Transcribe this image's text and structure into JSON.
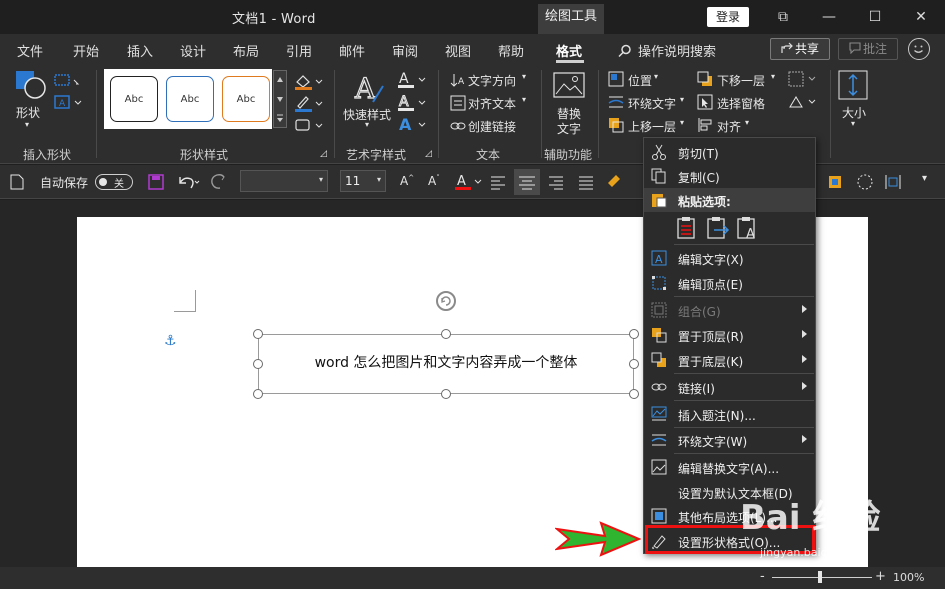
{
  "titlebar": {
    "doc_title": "文档1  -  Word",
    "context_tab": "绘图工具",
    "login": "登录",
    "restore_glyph": "⧉",
    "min_glyph": "—",
    "max_glyph": "☐",
    "close_glyph": "✕"
  },
  "tabs": [
    "文件",
    "开始",
    "插入",
    "设计",
    "布局",
    "引用",
    "邮件",
    "审阅",
    "视图",
    "帮助",
    "格式"
  ],
  "active_tab": "格式",
  "search": "操作说明搜索",
  "share": "共享",
  "comment": "批注",
  "ribbon": {
    "insert_shapes": {
      "label": "插入形状",
      "shape_btn": "形状"
    },
    "shape_styles": {
      "label": "形状样式",
      "styles": [
        "Abc",
        "Abc",
        "Abc"
      ],
      "colors": [
        "#222222",
        "#2f6fba",
        "#e07a1f"
      ]
    },
    "wordart": {
      "label": "艺术字样式",
      "quick": "快速样式"
    },
    "text": {
      "label": "文本",
      "direction": "文字方向",
      "align": "对齐文本",
      "link": "创建链接"
    },
    "accessibility": {
      "label": "辅助功能",
      "alt": "替换\n文字",
      "alt1": "替换",
      "alt2": "文字"
    },
    "arrange": {
      "position": "位置",
      "wrap": "环绕文字",
      "forward": "上移一层",
      "backward": "下移一层",
      "pane": "选择窗格",
      "align": "对齐"
    },
    "size": {
      "label": "大小"
    }
  },
  "qat": {
    "autosave": "自动保存",
    "toggle": "关",
    "font_size": "11"
  },
  "document": {
    "textbox_text": "word 怎么把图片和文字内容弄成一个整体"
  },
  "context_menu": {
    "items": [
      {
        "label": "剪切(T)",
        "disabled": false,
        "submenu": false
      },
      {
        "label": "复制(C)",
        "disabled": false,
        "submenu": false
      },
      {
        "label": "粘贴选项:",
        "disabled": false,
        "submenu": false
      },
      {
        "label": "编辑文字(X)",
        "disabled": false,
        "submenu": false
      },
      {
        "label": "编辑顶点(E)",
        "disabled": false,
        "submenu": false
      },
      {
        "label": "组合(G)",
        "disabled": true,
        "submenu": true
      },
      {
        "label": "置于顶层(R)",
        "disabled": false,
        "submenu": true
      },
      {
        "label": "置于底层(K)",
        "disabled": false,
        "submenu": true
      },
      {
        "label": "链接(I)",
        "disabled": false,
        "submenu": true
      },
      {
        "label": "插入题注(N)...",
        "disabled": false,
        "submenu": false
      },
      {
        "label": "环绕文字(W)",
        "disabled": false,
        "submenu": true
      },
      {
        "label": "编辑替换文字(A)...",
        "disabled": false,
        "submenu": false
      },
      {
        "label": "设置为默认文本框(D)",
        "disabled": false,
        "submenu": false
      },
      {
        "label": "其他布局选项(L)...",
        "disabled": false,
        "submenu": false
      },
      {
        "label": "设置形状格式(O)...",
        "disabled": false,
        "submenu": false
      }
    ]
  },
  "status": {
    "zoom": "100%",
    "minus": "-",
    "plus": "+"
  },
  "watermark": {
    "main": "Bai 经验",
    "sub": "jingyan.baidu.com"
  },
  "colors": {
    "accent_red": "#e11111",
    "arrow_green": "#2fb52f",
    "icon_blue": "#2a7bc8"
  }
}
